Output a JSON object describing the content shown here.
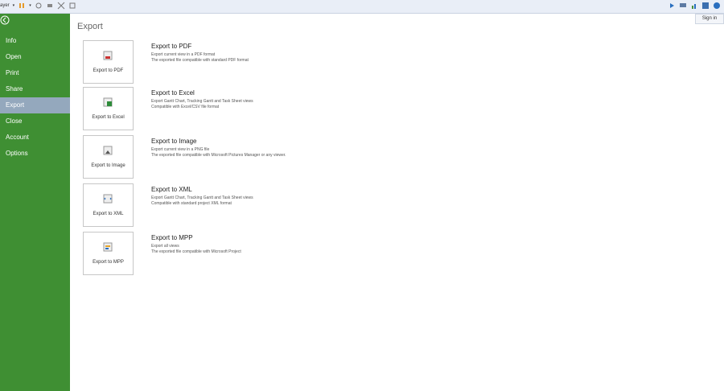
{
  "toolbar": {
    "layer_label": "ayer",
    "signin_label": "Sign in"
  },
  "sidebar": {
    "items": [
      {
        "label": "Info"
      },
      {
        "label": "Open"
      },
      {
        "label": "Print"
      },
      {
        "label": "Share"
      },
      {
        "label": "Export"
      },
      {
        "label": "Close"
      },
      {
        "label": "Account"
      },
      {
        "label": "Options"
      }
    ],
    "active_index": 4
  },
  "main": {
    "title": "Export",
    "options": [
      {
        "button": "Export to PDF",
        "title": "Export to PDF",
        "line1": "Export current view in a PDF format",
        "line2": "The exported file compatible with standard PDF format"
      },
      {
        "button": "Export to Excel",
        "title": "Export to Excel",
        "line1": "Export Gantt Chart, Tracking Gantt and Task Sheet views",
        "line2": "Compatible with Excel/CSV file format"
      },
      {
        "button": "Export to Image",
        "title": "Export to Image",
        "line1": "Export current view in a PNG file",
        "line2": "The exported file compatible with Microsoft Pictures Manager or any viewer."
      },
      {
        "button": "Export to XML",
        "title": "Export to XML",
        "line1": "Export Gantt Chart, Tracking Gantt and Task Sheet views",
        "line2": "Compatible with standard project XML format"
      },
      {
        "button": "Export to MPP",
        "title": "Export to MPP",
        "line1": "Export all views",
        "line2": "The exported file compatible with Microsoft Project"
      }
    ]
  },
  "colors": {
    "sidebar": "#3f8f33",
    "active_item": "#94a8bd"
  }
}
